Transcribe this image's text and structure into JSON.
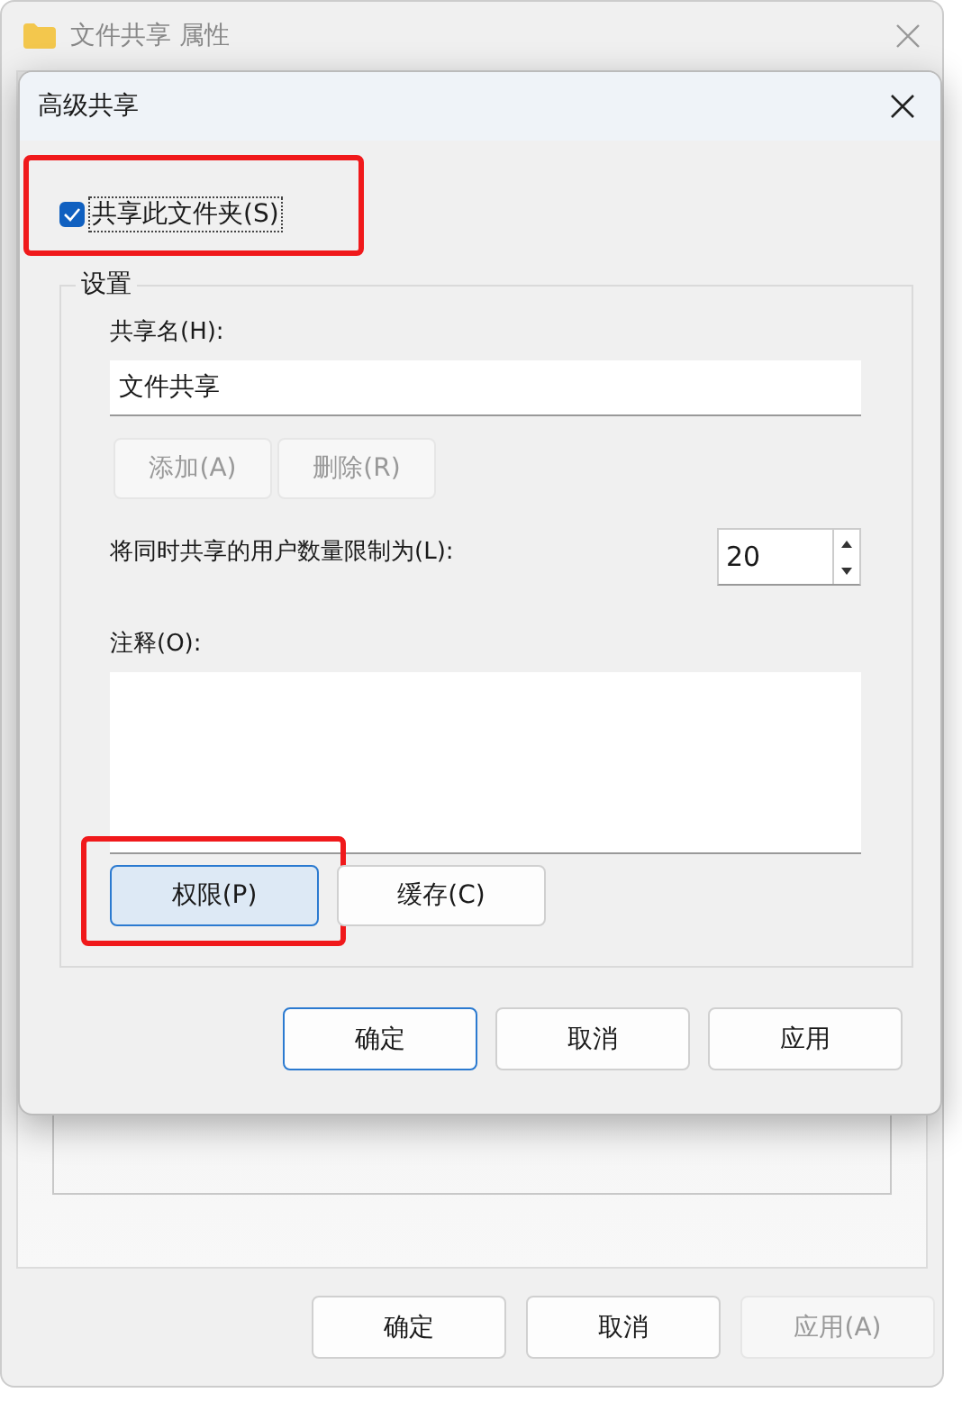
{
  "background_window": {
    "title": "文件共享 属性",
    "buttons": [
      {
        "label": "确定",
        "disabled": false
      },
      {
        "label": "取消",
        "disabled": false
      },
      {
        "label": "应用(A)",
        "disabled": true
      }
    ]
  },
  "dialog": {
    "title": "高级共享",
    "share_checkbox": {
      "label": "共享此文件夹(S)",
      "checked": true,
      "highlighted": true
    },
    "settings": {
      "title": "设置",
      "share_name_label": "共享名(H):",
      "share_name": "文件共享",
      "name_buttons": [
        {
          "label": "添加(A)",
          "disabled": true
        },
        {
          "label": "删除(R)",
          "disabled": true
        }
      ],
      "limit_label": "将同时共享的用户数量限制为(L):",
      "limit_value": "20",
      "comment_label": "注释(O):",
      "buttons": [
        {
          "label": "权限(P)",
          "focused": true,
          "highlighted": true
        },
        {
          "label": "缓存(C)",
          "focused": false,
          "highlighted": false
        }
      ]
    },
    "buttons": [
      {
        "label": "确定",
        "default": true
      },
      {
        "label": "取消",
        "default": false
      },
      {
        "label": "应用",
        "default": false
      }
    ]
  }
}
